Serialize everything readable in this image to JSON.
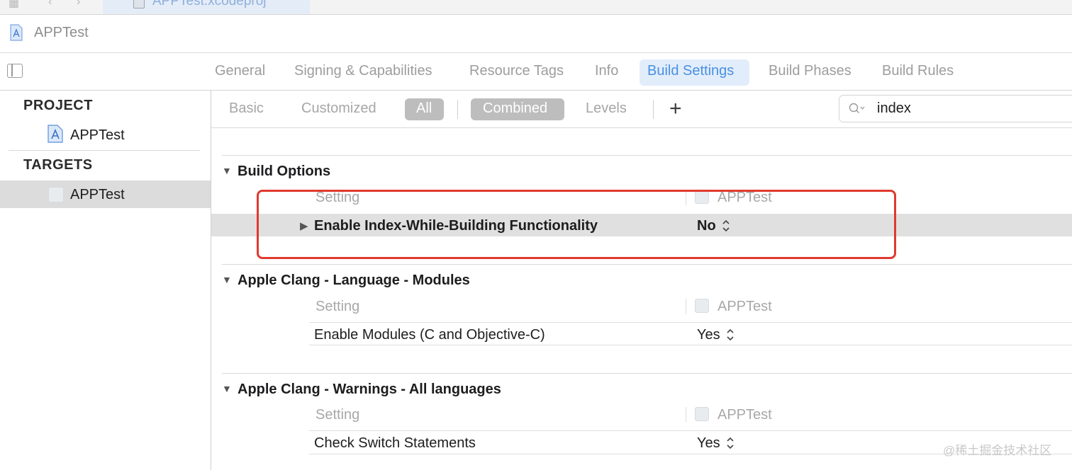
{
  "top_tab": {
    "label": "APPTest.xcodeproj"
  },
  "file_bar": {
    "title": "APPTest"
  },
  "editor_tabs": [
    {
      "label": "General"
    },
    {
      "label": "Signing & Capabilities"
    },
    {
      "label": "Resource Tags"
    },
    {
      "label": "Info"
    },
    {
      "label": "Build Settings",
      "active": true
    },
    {
      "label": "Build Phases"
    },
    {
      "label": "Build Rules"
    }
  ],
  "navigator": {
    "project_header": "PROJECT",
    "project_item": "APPTest",
    "targets_header": "TARGETS",
    "target_item": "APPTest"
  },
  "filter_bar": {
    "basic": "Basic",
    "customized": "Customized",
    "all": "All",
    "combined": "Combined",
    "levels": "Levels",
    "plus": "+",
    "search_value": "index"
  },
  "groups": [
    {
      "title": "Build Options",
      "column_setting": "Setting",
      "column_target": "APPTest",
      "row_name": "Enable Index-While-Building Functionality",
      "row_value": "No"
    },
    {
      "title": "Apple Clang - Language - Modules",
      "column_setting": "Setting",
      "column_target": "APPTest",
      "row_name": "Enable Modules (C and Objective-C)",
      "row_value": "Yes"
    },
    {
      "title": "Apple Clang - Warnings - All languages",
      "column_setting": "Setting",
      "column_target": "APPTest",
      "row_name": "Check Switch Statements",
      "row_value": "Yes"
    }
  ],
  "watermark": "@稀土掘金技术社区",
  "colors": {
    "accent": "#4a90e2",
    "highlight_box": "#e03a2f",
    "selected_row": "#e0e0e0"
  }
}
